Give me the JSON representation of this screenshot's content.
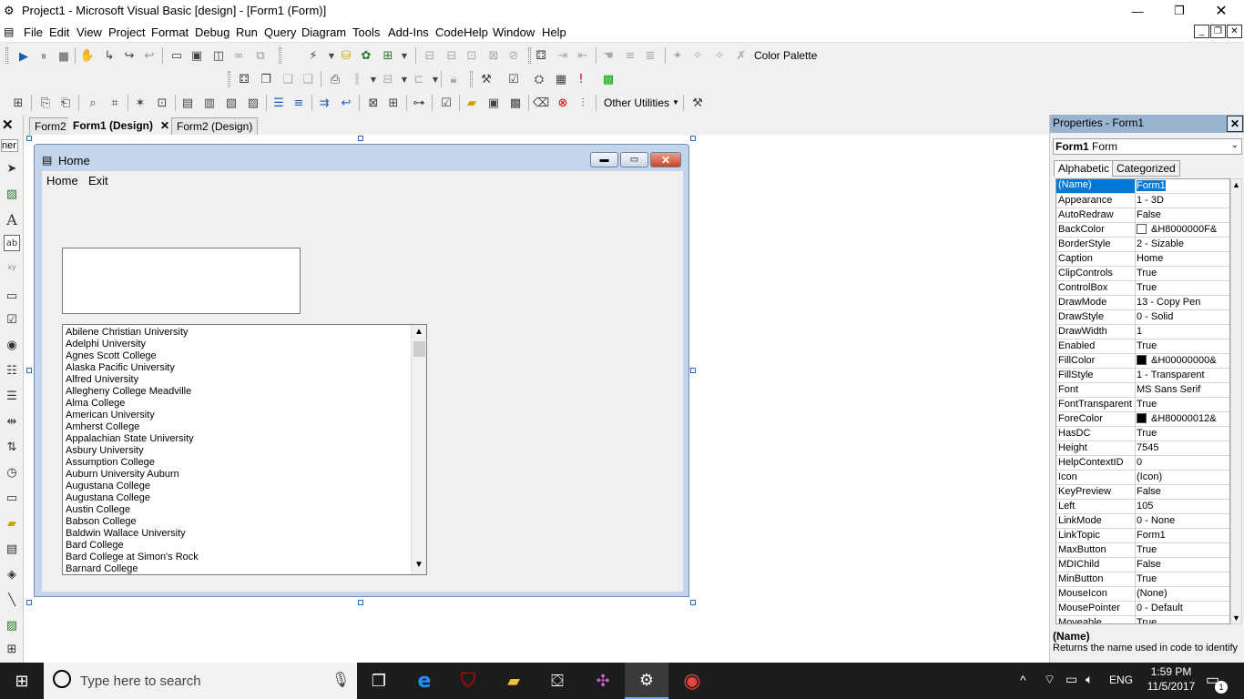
{
  "window": {
    "title": "Project1 - Microsoft Visual Basic [design] - [Form1 (Form)]"
  },
  "menubar": {
    "items": [
      "File",
      "Edit",
      "View",
      "Project",
      "Format",
      "Debug",
      "Run",
      "Query",
      "Diagram",
      "Tools",
      "Add-Ins",
      "CodeHelp",
      "Window",
      "Help"
    ]
  },
  "toolbar": {
    "color_palette": "Color Palette",
    "other_utilities": "Other Utilities"
  },
  "tabs": [
    {
      "label": "Form2"
    },
    {
      "label": "Form1 (Design)",
      "active": true
    },
    {
      "label": "Form2 (Design)"
    }
  ],
  "toolbox": {
    "partial_label": "ner"
  },
  "form": {
    "caption": "Home",
    "menu": [
      "Home",
      "Exit"
    ],
    "list_items": [
      "Abilene Christian University",
      "Adelphi University",
      "Agnes Scott College",
      "Alaska Pacific University",
      "Alfred University",
      "Allegheny College Meadville",
      "Alma College",
      "American University",
      "Amherst College",
      "Appalachian State University",
      "Asbury University",
      "Assumption College",
      "Auburn University Auburn",
      "Augustana College",
      "Augustana College",
      "Austin College",
      "Babson College",
      "Baldwin Wallace University",
      "Bard College",
      "Bard College at Simon's Rock",
      "Barnard College"
    ]
  },
  "properties": {
    "title": "Properties - Form1",
    "object_name": "Form1",
    "object_type": "Form",
    "tabs": [
      "Alphabetic",
      "Categorized"
    ],
    "rows": [
      {
        "name": "(Name)",
        "value": "Form1"
      },
      {
        "name": "Appearance",
        "value": "1 - 3D"
      },
      {
        "name": "AutoRedraw",
        "value": "False"
      },
      {
        "name": "BackColor",
        "value": "&H8000000F&",
        "swatch": "#ffffff"
      },
      {
        "name": "BorderStyle",
        "value": "2 - Sizable"
      },
      {
        "name": "Caption",
        "value": "Home"
      },
      {
        "name": "ClipControls",
        "value": "True"
      },
      {
        "name": "ControlBox",
        "value": "True"
      },
      {
        "name": "DrawMode",
        "value": "13 - Copy Pen"
      },
      {
        "name": "DrawStyle",
        "value": "0 - Solid"
      },
      {
        "name": "DrawWidth",
        "value": "1"
      },
      {
        "name": "Enabled",
        "value": "True"
      },
      {
        "name": "FillColor",
        "value": "&H00000000&",
        "swatch": "#000000"
      },
      {
        "name": "FillStyle",
        "value": "1 - Transparent"
      },
      {
        "name": "Font",
        "value": "MS Sans Serif"
      },
      {
        "name": "FontTransparent",
        "value": "True"
      },
      {
        "name": "ForeColor",
        "value": "&H80000012&",
        "swatch": "#000000"
      },
      {
        "name": "HasDC",
        "value": "True"
      },
      {
        "name": "Height",
        "value": "7545"
      },
      {
        "name": "HelpContextID",
        "value": "0"
      },
      {
        "name": "Icon",
        "value": "(Icon)"
      },
      {
        "name": "KeyPreview",
        "value": "False"
      },
      {
        "name": "Left",
        "value": "105"
      },
      {
        "name": "LinkMode",
        "value": "0 - None"
      },
      {
        "name": "LinkTopic",
        "value": "Form1"
      },
      {
        "name": "MaxButton",
        "value": "True"
      },
      {
        "name": "MDIChild",
        "value": "False"
      },
      {
        "name": "MinButton",
        "value": "True"
      },
      {
        "name": "MouseIcon",
        "value": "(None)"
      },
      {
        "name": "MousePointer",
        "value": "0 - Default"
      },
      {
        "name": "Moveable",
        "value": "True"
      }
    ],
    "desc_title": "(Name)",
    "desc_text": "Returns the name used in code to identify"
  },
  "taskbar": {
    "search_placeholder": "Type here to search",
    "language": "ENG",
    "time": "1:59 PM",
    "date": "11/5/2017",
    "notification_count": "1"
  }
}
